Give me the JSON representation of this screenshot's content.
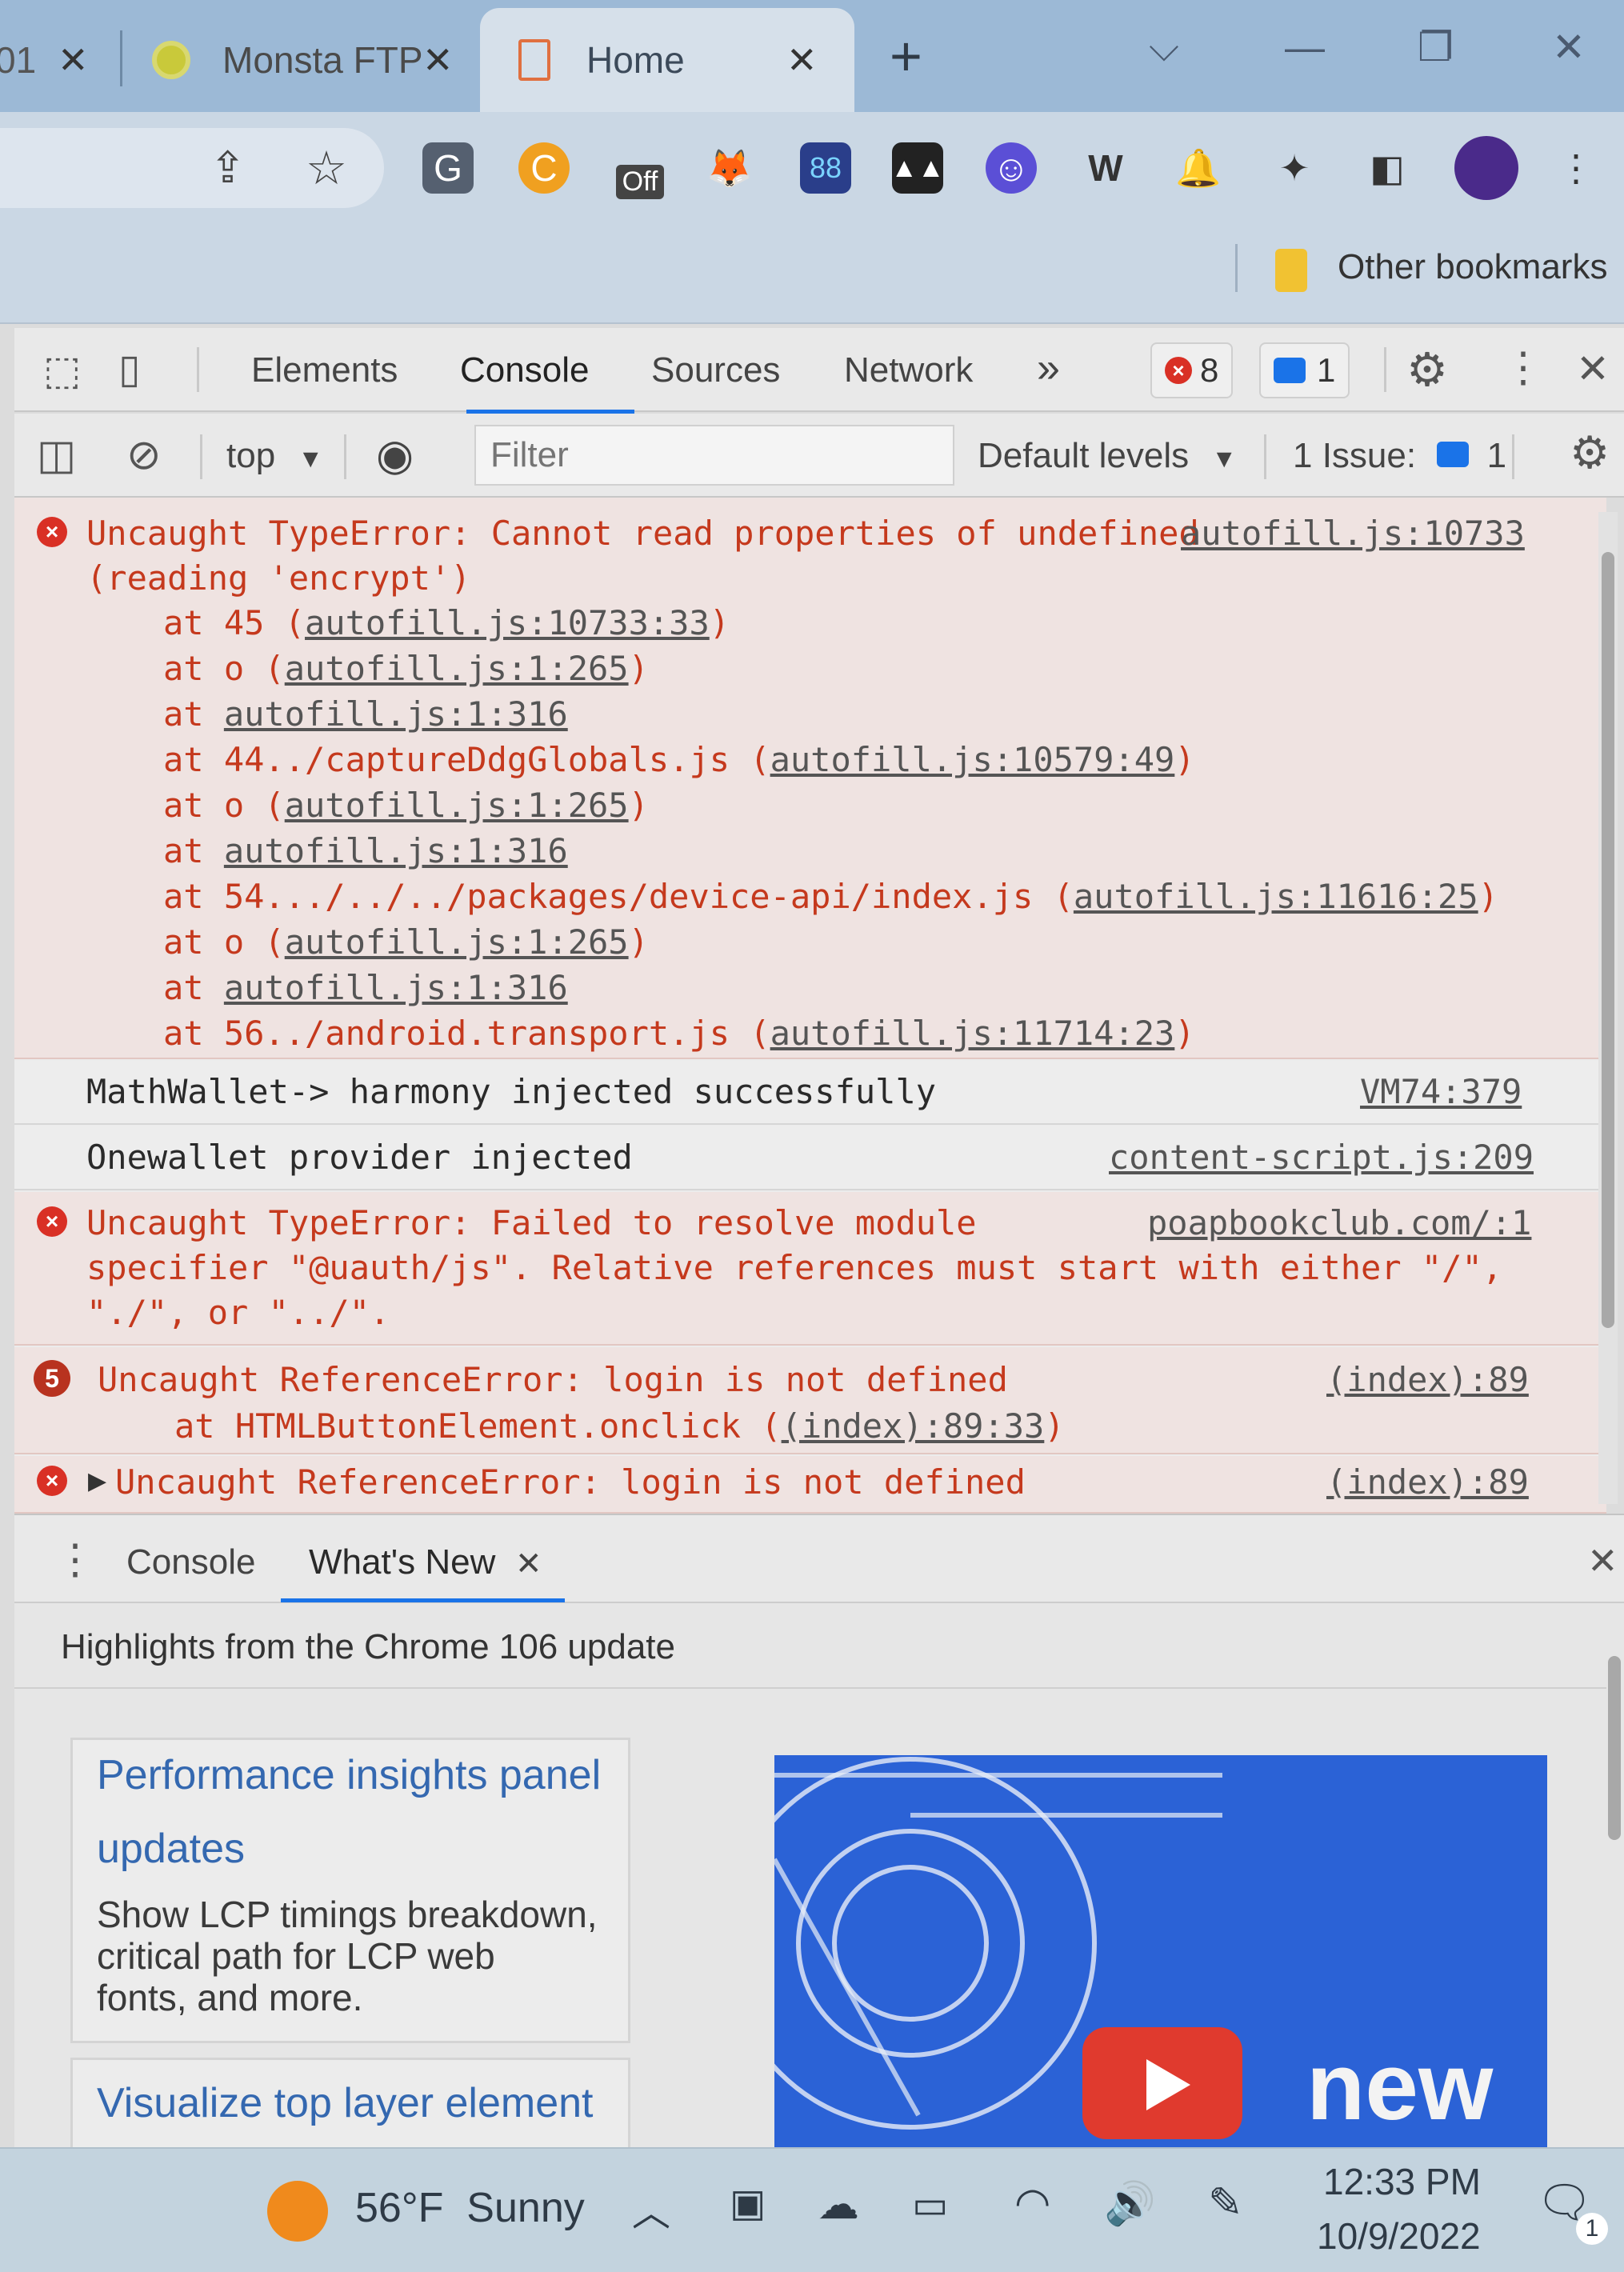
{
  "browser": {
    "tabs": [
      {
        "label": "01",
        "close": "✕"
      },
      {
        "label": "Monsta FTP",
        "close": "✕"
      },
      {
        "label": "Home",
        "close": "✕"
      }
    ],
    "new_tab": "+",
    "extensions": {
      "off_badge": "Off"
    },
    "bookmarks": {
      "other": "Other bookmarks"
    }
  },
  "devtools": {
    "tabs": [
      "Elements",
      "Console",
      "Sources",
      "Network"
    ],
    "more": "»",
    "error_count": "8",
    "message_count": "1",
    "context": "top",
    "filter_placeholder": "Filter",
    "levels": "Default levels",
    "issues_label": "1 Issue:",
    "issues_count": "1"
  },
  "console": {
    "messages": [
      {
        "type": "error",
        "lines": [
          "Uncaught TypeError: Cannot read properties of undefined",
          "(reading 'encrypt')"
        ],
        "source": "autofill.js:10733",
        "stack": [
          {
            "prefix": "at 45 (",
            "link": "autofill.js:10733:33",
            "suffix": ")"
          },
          {
            "prefix": "at o (",
            "link": "autofill.js:1:265",
            "suffix": ")"
          },
          {
            "prefix": "at ",
            "link": "autofill.js:1:316",
            "suffix": ""
          },
          {
            "prefix": "at 44../captureDdgGlobals.js (",
            "link": "autofill.js:10579:49",
            "suffix": ")"
          },
          {
            "prefix": "at o (",
            "link": "autofill.js:1:265",
            "suffix": ")"
          },
          {
            "prefix": "at ",
            "link": "autofill.js:1:316",
            "suffix": ""
          },
          {
            "prefix": "at 54.../../../packages/device-api/index.js (",
            "link": "autofill.js:11616:25",
            "suffix": ")"
          },
          {
            "prefix": "at o (",
            "link": "autofill.js:1:265",
            "suffix": ")"
          },
          {
            "prefix": "at ",
            "link": "autofill.js:1:316",
            "suffix": ""
          },
          {
            "prefix": "at 56../android.transport.js (",
            "link": "autofill.js:11714:23",
            "suffix": ")"
          }
        ]
      },
      {
        "type": "log",
        "text": "MathWallet-> harmony injected successfully",
        "source": "VM74:379"
      },
      {
        "type": "log",
        "text": "Onewallet provider injected",
        "source": "content-script.js:209"
      },
      {
        "type": "error",
        "lines": [
          "Uncaught TypeError: Failed to resolve module",
          "specifier \"@uauth/js\". Relative references must start with either \"/\",",
          "\"./\", or \"../\"."
        ],
        "source": "poapbookclub.com/:1"
      },
      {
        "type": "error",
        "repeat": "5",
        "lines": [
          "Uncaught ReferenceError: login is not defined"
        ],
        "stack": [
          {
            "prefix": "at HTMLButtonElement.onclick (",
            "link": "(index):89:33",
            "suffix": ")"
          }
        ],
        "source": "(index):89"
      },
      {
        "type": "error",
        "collapsed": true,
        "lines": [
          "Uncaught ReferenceError: login is not defined"
        ],
        "source": "(index):89"
      }
    ]
  },
  "drawer": {
    "tabs": [
      "Console",
      "What's New"
    ],
    "close_tab": "✕",
    "highlights": "Highlights from the Chrome 106 update",
    "cards": [
      {
        "title_lines": [
          "Performance insights panel",
          "updates"
        ],
        "desc_lines": [
          "Show LCP timings breakdown,",
          "critical path for LCP web",
          "fonts, and more."
        ]
      },
      {
        "title_lines": [
          "Visualize top layer element"
        ],
        "desc_lines": []
      }
    ],
    "promo_word": "new"
  },
  "taskbar": {
    "weather": "56°F  Sunny",
    "time": "12:33 PM",
    "date": "10/9/2022",
    "notifications": "1"
  }
}
